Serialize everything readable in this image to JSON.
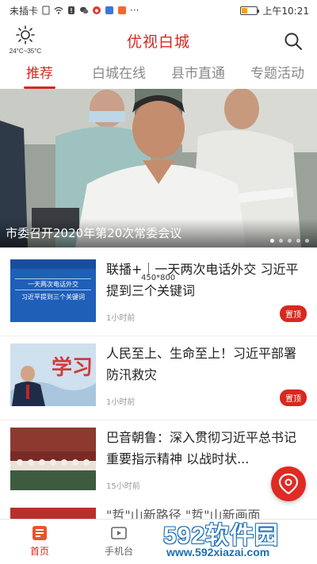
{
  "status": {
    "carrier": "未插卡",
    "time": "上午10:21",
    "battery_level": 0.35
  },
  "header": {
    "title": "优视白城",
    "weather_temp": "24°C~35°C",
    "weather_icon": "sun-icon",
    "search_icon": "search-icon"
  },
  "tabs": [
    {
      "label": "推荐",
      "active": true
    },
    {
      "label": "白城在线",
      "active": false
    },
    {
      "label": "县市直通",
      "active": false
    },
    {
      "label": "专题活动",
      "active": false
    }
  ],
  "banner": {
    "caption": "市委召开2020年第20次常委会议",
    "slide_count": 5,
    "current_slide": 1
  },
  "news": [
    {
      "headline": "联播+｜一天两次电话外交 习近平提到三个关键词",
      "time": "1小时前",
      "badge": "置顶",
      "thumb_text_1": "一天两次电话外交",
      "thumb_text_2": "习近平提到三个关键词"
    },
    {
      "headline": "人民至上、生命至上！习近平部署防汛救灾",
      "time": "1小时前",
      "badge": "置顶",
      "thumb_text_1": "学习"
    },
    {
      "headline": "巴音朝鲁：深入贯彻习近平总书记重要指示精神 以战时状...",
      "time": "15小时前",
      "badge": ""
    }
  ],
  "overlay_dimension": "450*800",
  "partial_next_headline": "\"哲\"山新路径 \"哲\"山新画面",
  "bottom_nav": [
    {
      "label": "首页",
      "icon": "home-news-icon",
      "active": true
    },
    {
      "label": "手机台",
      "icon": "tv-icon",
      "active": false
    }
  ],
  "watermark": {
    "main": "592软件园",
    "url": "www.592xiazai.com"
  },
  "colors": {
    "accent": "#d8281f",
    "watermark_blue": "#1b6fb5"
  }
}
